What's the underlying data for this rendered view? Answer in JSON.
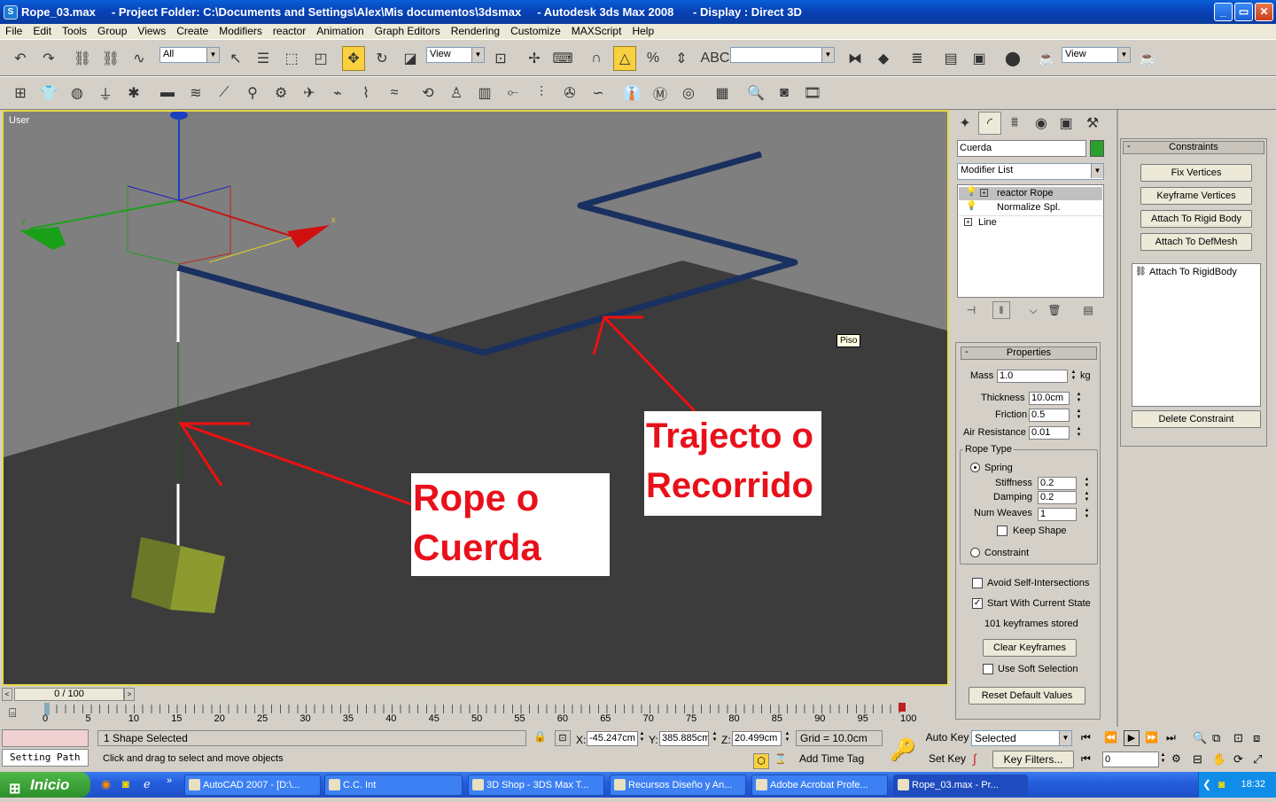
{
  "title_bar": {
    "text": "Rope_03.max     - Project Folder: C:\\Documents and Settings\\Alex\\Mis documentos\\3dsmax     - Autodesk 3ds Max 2008      - Display : Direct 3D",
    "app_icon": "3dsmax-icon"
  },
  "window_buttons": {
    "minimize": "_",
    "maximize": "▭",
    "close": "✕"
  },
  "menu": [
    "File",
    "Edit",
    "Tools",
    "Group",
    "Views",
    "Create",
    "Modifiers",
    "reactor",
    "Animation",
    "Graph Editors",
    "Rendering",
    "Customize",
    "MAXScript",
    "Help"
  ],
  "main_toolbar": {
    "selection_filter": "All",
    "ref_coord": "View",
    "named_selection": "",
    "render_view": "View"
  },
  "viewport": {
    "label": "User",
    "tooltip": "Piso",
    "axis_x": "x",
    "axis_y": "y"
  },
  "annotations": {
    "rope_line1": "Rope o",
    "rope_line2": "Cuerda",
    "path_line1": "Trajecto o",
    "path_line2": "Recorrido"
  },
  "modify_panel": {
    "object_name": "Cuerda",
    "object_color": "#2ca02c",
    "modifier_list": "Modifier List",
    "stack": [
      {
        "label": "reactor Rope",
        "selected": true
      },
      {
        "label": "Normalize Spl.",
        "selected": false
      },
      {
        "label": "Line",
        "selected": false
      }
    ],
    "properties": {
      "title": "Properties",
      "mass_label": "Mass",
      "mass": "1.0",
      "mass_unit": "kg",
      "thickness_label": "Thickness",
      "thickness": "10.0cm",
      "friction_label": "Friction",
      "friction": "0.5",
      "air_label": "Air Resistance",
      "air": "0.01",
      "rope_type_label": "Rope Type",
      "spring_label": "Spring",
      "stiffness_label": "Stiffness",
      "stiffness": "0.2",
      "damping_label": "Damping",
      "damping": "0.2",
      "weaves_label": "Num Weaves",
      "weaves": "1",
      "keep_shape_label": "Keep Shape",
      "constraint_label": "Constraint",
      "avoid_label": "Avoid Self-Intersections",
      "start_label": "Start With Current State",
      "keyframes_label": "101 keyframes stored",
      "clear_button": "Clear Keyframes",
      "soft_label": "Use Soft Selection",
      "reset_button": "Reset Default Values"
    }
  },
  "constraints": {
    "title": "Constraints",
    "fix_vertices": "Fix Vertices",
    "keyframe_vertices": "Keyframe Vertices",
    "attach_rigid": "Attach To Rigid Body",
    "attach_def": "Attach To DefMesh",
    "list_item": "Attach To RigidBody",
    "delete": "Delete Constraint"
  },
  "timeline": {
    "frame_slider": "0 / 100",
    "ticks": [
      "0",
      "5",
      "10",
      "15",
      "20",
      "25",
      "30",
      "35",
      "40",
      "45",
      "50",
      "55",
      "60",
      "65",
      "70",
      "75",
      "80",
      "85",
      "90",
      "95",
      "100"
    ]
  },
  "status": {
    "maxscript_pink": "",
    "setting_path": "Setting Path",
    "selected": "1 Shape Selected",
    "prompt": "Click and drag to select and move objects",
    "x_label": "X:",
    "x": "-45.247cm",
    "y_label": "Y:",
    "y": "385.885cm",
    "z_label": "Z:",
    "z": "20.499cm",
    "grid": "Grid = 10.0cm",
    "add_time_tag": "Add Time Tag",
    "auto_key": "Auto Key",
    "set_key": "Set Key",
    "key_mode": "Selected",
    "key_filters": "Key Filters...",
    "current_frame": "0"
  },
  "taskbar": {
    "start": "Inicio",
    "tasks": [
      "AutoCAD 2007 - [D:\\...",
      "C.C. Int",
      "3D Shop - 3DS Max T...",
      "Recursos Diseño y An...",
      "Adobe Acrobat Profe...",
      "Rope_03.max      - Pr..."
    ],
    "clock": "18:32"
  }
}
